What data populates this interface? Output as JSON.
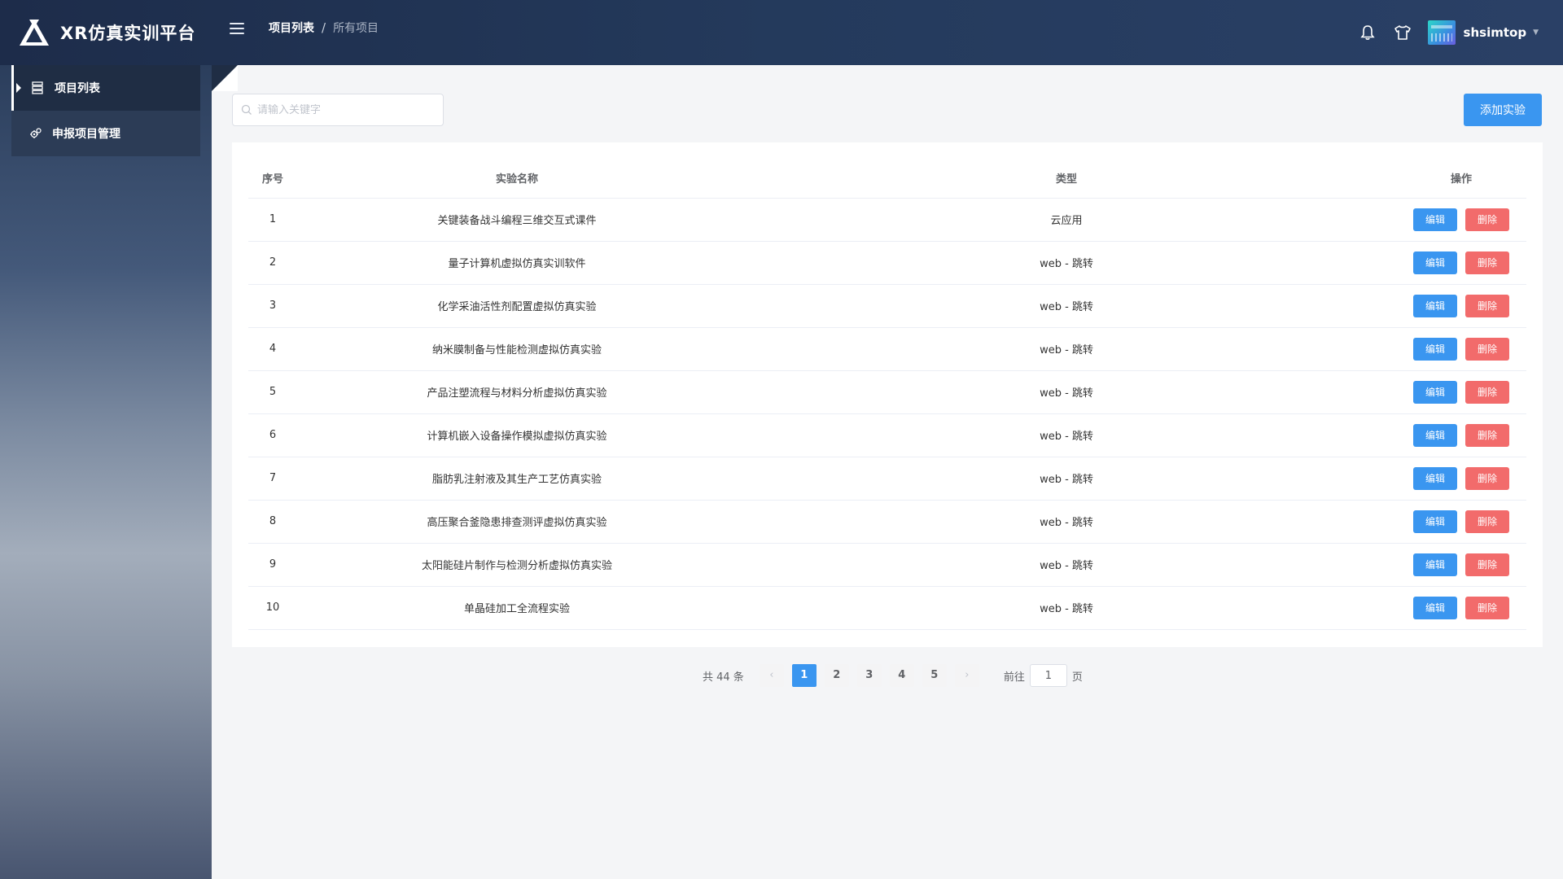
{
  "app": {
    "title": "XR仿真实训平台"
  },
  "breadcrumb": {
    "current": "项目列表",
    "separator": "/",
    "last": "所有项目"
  },
  "user": {
    "name": "shsimtop"
  },
  "icons": {
    "menu": "hamburger-icon",
    "bell": "bell-icon",
    "theme": "tshirt-icon",
    "search": "search-icon"
  },
  "colors": {
    "primary": "#3a96f0",
    "danger": "#f26b6b",
    "header": "#1d2c4a"
  },
  "sidebar": {
    "items": [
      {
        "label": "项目列表",
        "icon": "list-icon",
        "active": true
      },
      {
        "label": "申报项目管理",
        "icon": "gears-icon",
        "active": false
      }
    ]
  },
  "search": {
    "placeholder": "请输入关键字",
    "value": ""
  },
  "toolbar": {
    "add_label": "添加实验"
  },
  "table": {
    "headers": [
      "序号",
      "实验名称",
      "类型",
      "操作"
    ],
    "edit_label": "编辑",
    "delete_label": "删除",
    "rows": [
      {
        "idx": "1",
        "name": "关键装备战斗编程三维交互式课件",
        "type": "云应用"
      },
      {
        "idx": "2",
        "name": "量子计算机虚拟仿真实训软件",
        "type": "web - 跳转"
      },
      {
        "idx": "3",
        "name": "化学采油活性剂配置虚拟仿真实验",
        "type": "web - 跳转"
      },
      {
        "idx": "4",
        "name": "纳米膜制备与性能检测虚拟仿真实验",
        "type": "web - 跳转"
      },
      {
        "idx": "5",
        "name": "产品注塑流程与材料分析虚拟仿真实验",
        "type": "web - 跳转"
      },
      {
        "idx": "6",
        "name": "计算机嵌入设备操作模拟虚拟仿真实验",
        "type": "web - 跳转"
      },
      {
        "idx": "7",
        "name": "脂肪乳注射液及其生产工艺仿真实验",
        "type": "web - 跳转"
      },
      {
        "idx": "8",
        "name": "高压聚合釜隐患排查测评虚拟仿真实验",
        "type": "web - 跳转"
      },
      {
        "idx": "9",
        "name": "太阳能硅片制作与检测分析虚拟仿真实验",
        "type": "web - 跳转"
      },
      {
        "idx": "10",
        "name": "单晶硅加工全流程实验",
        "type": "web - 跳转"
      }
    ]
  },
  "pagination": {
    "total_text": "共 44 条",
    "prev": "‹",
    "next": "›",
    "pages": [
      "1",
      "2",
      "3",
      "4",
      "5"
    ],
    "current": "1",
    "goto_prefix": "前往",
    "goto_value": "1",
    "goto_suffix": "页"
  }
}
